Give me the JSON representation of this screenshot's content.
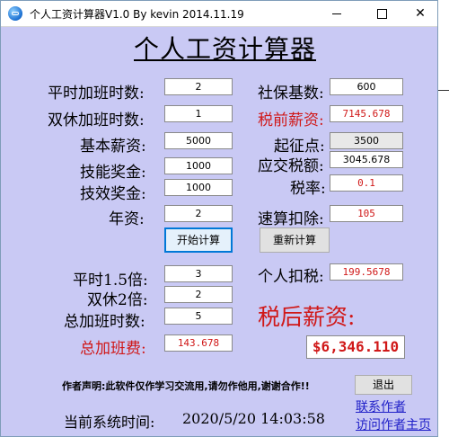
{
  "window": {
    "title": "个人工资计算器V1.0 By kevin 2014.11.19"
  },
  "heading": "个人工资计算器",
  "fields": {
    "overtime_weekday_hours": {
      "label": "平时加班时数:",
      "value": "2"
    },
    "overtime_weekend_hours": {
      "label": "双休加班时数:",
      "value": "1"
    },
    "base_salary": {
      "label": "基本薪资:",
      "value": "5000"
    },
    "skill_bonus": {
      "label": "技能奖金:",
      "value": "1000"
    },
    "performance_bonus": {
      "label": "技效奖金:",
      "value": "1000"
    },
    "seniority": {
      "label": "年资:",
      "value": "2"
    },
    "social_security_base": {
      "label": "社保基数:",
      "value": "600"
    },
    "pre_tax_salary": {
      "label": "税前薪资:",
      "value": "7145.678"
    },
    "threshold": {
      "label": "起征点:",
      "value": "3500"
    },
    "taxable_amount": {
      "label": "应交税额:",
      "value": "3045.678"
    },
    "tax_rate": {
      "label": "税率:",
      "value": "0.1"
    },
    "quick_deduction": {
      "label": "速算扣除:",
      "value": "105"
    },
    "weekday_multiplier": {
      "label": "平时1.5倍:",
      "value": "3"
    },
    "weekend_multiplier": {
      "label": "双休2倍:",
      "value": "2"
    },
    "total_overtime_hours": {
      "label": "总加班时数:",
      "value": "5"
    },
    "total_overtime_pay": {
      "label": "总加班费:",
      "value": "143.678"
    },
    "personal_income_tax": {
      "label": "个人扣税:",
      "value": "199.5678"
    }
  },
  "buttons": {
    "calculate": "开始计算",
    "recalculate": "重新计算",
    "exit": "退出"
  },
  "after_tax": {
    "label": "税后薪资:",
    "value": "$6,346.110"
  },
  "disclaimer": "作者声明:此软件仅作学习交流用,请勿作他用,谢谢合作!!",
  "links": {
    "contact": "联系作者",
    "homepage": "访问作者主页"
  },
  "system_time": {
    "label": "当前系统时间:",
    "value": "2020/5/20 14:03:58"
  },
  "colors": {
    "background": "#c9c9f4",
    "accent_red": "#d01818",
    "link_blue": "#2020c8"
  }
}
